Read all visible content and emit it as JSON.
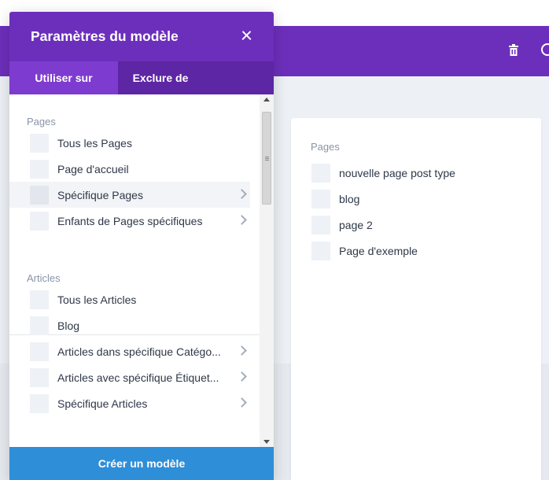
{
  "modal": {
    "title": "Paramètres du modèle",
    "tabs": [
      {
        "label": "Utiliser sur",
        "active": true
      },
      {
        "label": "Exclure de",
        "active": false
      }
    ],
    "sections": [
      {
        "title": "Pages",
        "items": [
          {
            "label": "Tous les Pages",
            "chevron": false
          },
          {
            "label": "Page d'accueil",
            "chevron": false
          },
          {
            "label": "Spécifique Pages",
            "chevron": true,
            "highlighted": true
          },
          {
            "label": "Enfants de Pages spécifiques",
            "chevron": true
          }
        ]
      },
      {
        "title": "Articles",
        "items": [
          {
            "label": "Tous les Articles",
            "chevron": false
          },
          {
            "label": "Blog",
            "chevron": false
          },
          {
            "label": "Articles dans spécifique Catégo...",
            "chevron": true
          },
          {
            "label": "Articles avec spécifique Étiquet...",
            "chevron": true
          },
          {
            "label": "Spécifique Articles",
            "chevron": true
          }
        ]
      }
    ],
    "create_button": "Créer un modèle"
  },
  "specific_panel": {
    "title": "Pages",
    "items": [
      {
        "label": "nouvelle page post type"
      },
      {
        "label": "blog"
      },
      {
        "label": "page 2"
      },
      {
        "label": "Page d'exemple"
      }
    ]
  },
  "toolbar": {
    "icons": [
      "trash-icon",
      "search-icon"
    ]
  },
  "colors": {
    "purple_header": "#6c2fbb",
    "tab_bar": "#5d26a4",
    "tab_active": "#7e3bd0",
    "create_button": "#2e8ed8",
    "section_title": "#8a94a6"
  }
}
